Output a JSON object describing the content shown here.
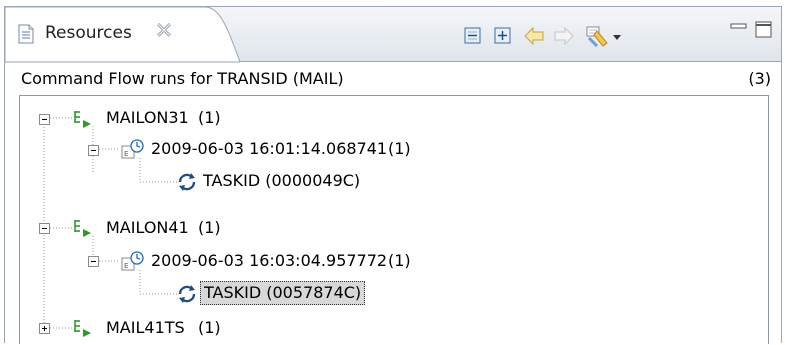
{
  "tab": {
    "label": "Resources",
    "icon": "document-icon",
    "close_icon": "close-icon"
  },
  "toolbar": {
    "buttons": [
      "collapse-all-icon",
      "expand-all-icon",
      "back-icon",
      "forward-icon",
      "filter-icon",
      "view-menu-icon"
    ],
    "window": [
      "minimize-icon",
      "maximize-icon"
    ]
  },
  "header": {
    "title": "Command Flow runs for TRANSID (MAIL)",
    "count": "(3)"
  },
  "tree": {
    "nodes": [
      {
        "label": "MAILON31",
        "count": "(1)",
        "icon": "program-flow-icon",
        "expanded": true
      },
      {
        "label": "2009-06-03 16:01:14.068741",
        "count": "(1)",
        "icon": "timestamp-run-icon",
        "expanded": true
      },
      {
        "label": "TASKID (0000049C)",
        "count": "",
        "icon": "task-cycle-icon",
        "expanded": null
      },
      {
        "label": "MAILON41",
        "count": "(1)",
        "icon": "program-flow-icon",
        "expanded": true
      },
      {
        "label": "2009-06-03 16:03:04.957772",
        "count": "(1)",
        "icon": "timestamp-run-icon",
        "expanded": true
      },
      {
        "label": "TASKID (0057874C)",
        "count": "",
        "icon": "task-cycle-icon",
        "expanded": null,
        "selected": true
      },
      {
        "label": "MAIL41TS",
        "count": "(1)",
        "icon": "program-flow-icon",
        "expanded": false
      }
    ]
  },
  "colors": {
    "accent_green": "#2e9a2e",
    "accent_blue": "#1f6bb5",
    "selection_bg": "#d8d8d8"
  }
}
